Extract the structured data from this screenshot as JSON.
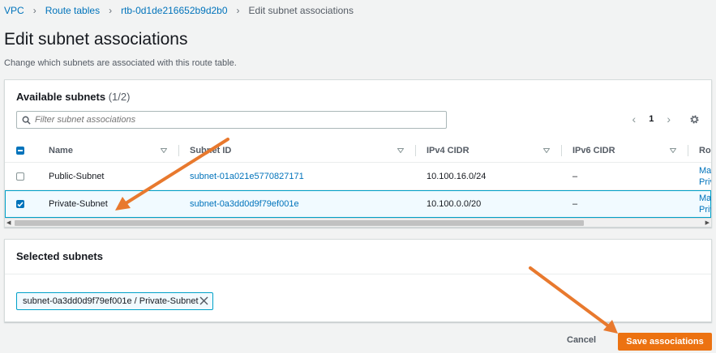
{
  "breadcrumb": {
    "items": [
      "VPC",
      "Route tables",
      "rtb-0d1de216652b9d2b0"
    ],
    "current": "Edit subnet associations"
  },
  "page": {
    "title": "Edit subnet associations",
    "description": "Change which subnets are associated with this route table."
  },
  "available": {
    "title": "Available subnets",
    "count": "(1/2)",
    "search_placeholder": "Filter subnet associations",
    "page_number": "1",
    "columns": [
      "Name",
      "Subnet ID",
      "IPv4 CIDR",
      "IPv6 CIDR",
      "Rou"
    ],
    "rows": [
      {
        "name": "Public-Subnet",
        "subnet_id": "subnet-01a021e5770827171",
        "ipv4": "10.100.16.0/24",
        "ipv6": "–",
        "route_1": "Mai",
        "route_2": "Priv",
        "checked": false
      },
      {
        "name": "Private-Subnet",
        "subnet_id": "subnet-0a3dd0d9f79ef001e",
        "ipv4": "10.100.0.0/20",
        "ipv6": "–",
        "route_1": "Mai",
        "route_2": "Priv",
        "checked": true
      }
    ]
  },
  "selected": {
    "title": "Selected subnets",
    "token_label": "subnet-0a3dd0d9f79ef001e / Private-Subnet"
  },
  "actions": {
    "cancel": "Cancel",
    "save": "Save associations"
  },
  "colors": {
    "accent": "#ec7211",
    "link": "#0073bb",
    "selection": "#00a1c9",
    "annotation_arrow": "#e8792e"
  },
  "icons": [
    "search-icon",
    "chevron-left-icon",
    "chevron-right-icon",
    "gear-icon",
    "sort-icon",
    "check-icon",
    "close-icon"
  ]
}
